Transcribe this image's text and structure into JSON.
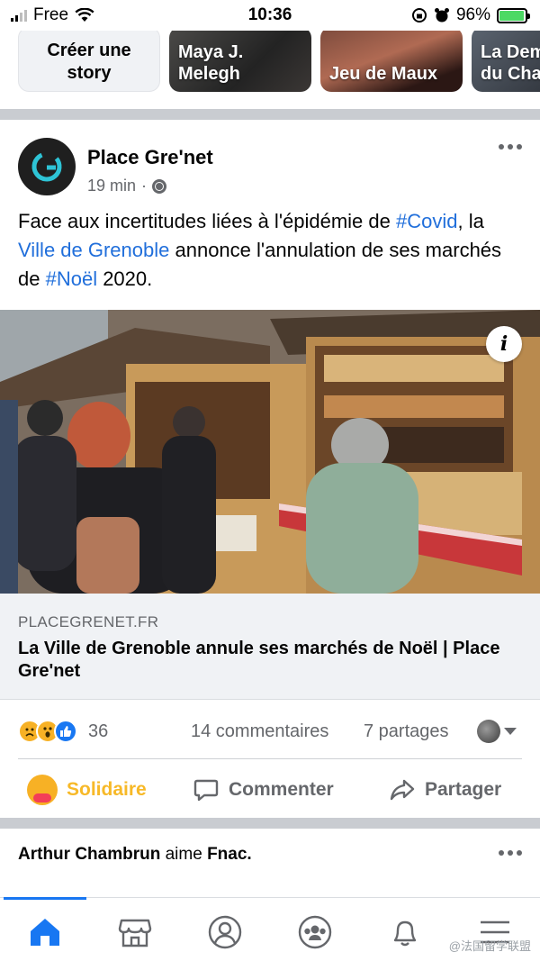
{
  "status_bar": {
    "carrier": "Free",
    "time": "10:36",
    "battery": "96%",
    "battery_level": 0.96,
    "battery_color": "#4cd964"
  },
  "stories": {
    "create_label": "Créer une story",
    "items": [
      {
        "label": "Maya J. Melegh"
      },
      {
        "label": "Jeu de Maux"
      },
      {
        "label": "La Dem du Cha"
      }
    ]
  },
  "post": {
    "page_name": "Place Gre'net",
    "time": "19 min",
    "audience_icon": "globe-icon",
    "text": {
      "p1": "Face aux incertitudes liées à l'épidémie de ",
      "tag1": "#Covid",
      "p2": ", la ",
      "tag2": "Ville de Grenoble",
      "p3": " annonce l'annulation de ses marchés de ",
      "tag3": "#Noël",
      "p4": " 2020."
    },
    "link": {
      "domain": "PLACEGRENET.FR",
      "title": "La Ville de Grenoble annule ses marchés de Noël | Place Gre'net"
    },
    "reactions": {
      "count": "36",
      "comments": "14 commentaires",
      "shares": "7 partages"
    },
    "actions": {
      "solidaire": "Solidaire",
      "comment": "Commenter",
      "share": "Partager"
    }
  },
  "next_post": {
    "actor": "Arthur Chambrun",
    "verb": " aime ",
    "target": "Fnac."
  },
  "nav": {
    "items": [
      "home-icon",
      "marketplace-icon",
      "profile-icon",
      "groups-icon",
      "notifications-icon",
      "menu-icon"
    ]
  },
  "watermark": "@法国留学联盟",
  "colors": {
    "link_blue": "#216fdb",
    "accent": "#1877f2",
    "solidaire": "#f7b928"
  }
}
